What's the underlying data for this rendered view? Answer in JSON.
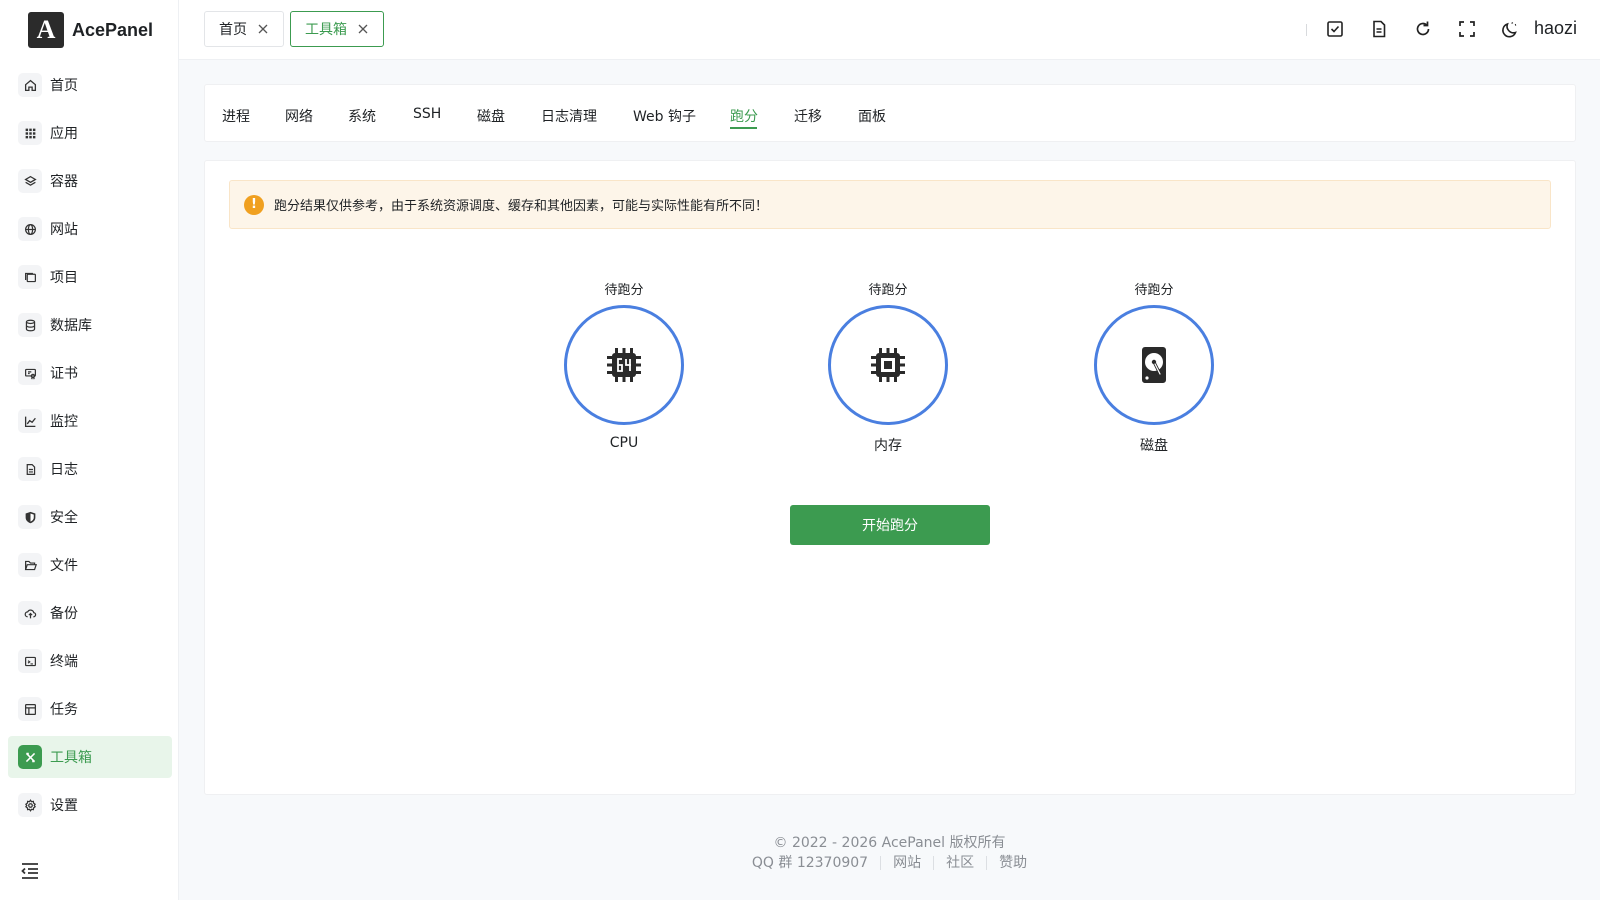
{
  "app": {
    "logo_text": "AcePanel",
    "logo_mark": "A"
  },
  "sidebar": {
    "items": [
      {
        "label": "首页",
        "icon": "home-icon"
      },
      {
        "label": "应用",
        "icon": "grid-icon"
      },
      {
        "label": "容器",
        "icon": "layers-icon"
      },
      {
        "label": "网站",
        "icon": "globe-icon"
      },
      {
        "label": "项目",
        "icon": "folders-icon"
      },
      {
        "label": "数据库",
        "icon": "database-icon"
      },
      {
        "label": "证书",
        "icon": "certificate-icon"
      },
      {
        "label": "监控",
        "icon": "chart-line-icon"
      },
      {
        "label": "日志",
        "icon": "document-icon"
      },
      {
        "label": "安全",
        "icon": "shield-icon"
      },
      {
        "label": "文件",
        "icon": "folder-open-icon"
      },
      {
        "label": "备份",
        "icon": "cloud-upload-icon"
      },
      {
        "label": "终端",
        "icon": "terminal-icon"
      },
      {
        "label": "任务",
        "icon": "task-list-icon"
      },
      {
        "label": "工具箱",
        "icon": "tools-icon",
        "active": true
      },
      {
        "label": "设置",
        "icon": "gear-icon"
      }
    ]
  },
  "header": {
    "tabs": [
      {
        "label": "首页",
        "active": false
      },
      {
        "label": "工具箱",
        "active": true
      }
    ],
    "icons": [
      "checkbox-icon",
      "notes-icon",
      "refresh-icon",
      "fullscreen-icon",
      "moon-icon"
    ],
    "username": "haozi"
  },
  "subtabs": {
    "items": [
      "进程",
      "网络",
      "系统",
      "SSH",
      "磁盘",
      "日志清理",
      "Web 钩子",
      "跑分",
      "迁移",
      "面板"
    ],
    "active": "跑分"
  },
  "benchmark": {
    "notice": "跑分结果仅供参考，由于系统资源调度、缓存和其他因素，可能与实际性能有所不同！",
    "cards": [
      {
        "status": "待跑分",
        "label": "CPU",
        "icon": "cpu-64-icon"
      },
      {
        "status": "待跑分",
        "label": "内存",
        "icon": "memory-chip-icon"
      },
      {
        "status": "待跑分",
        "label": "磁盘",
        "icon": "hard-drive-icon"
      }
    ],
    "start_button": "开始跑分"
  },
  "footer": {
    "copyright": "© 2022 - 2026 AcePanel 版权所有",
    "qq": "QQ 群 12370907",
    "links": [
      "网站",
      "社区",
      "赞助"
    ]
  },
  "colors": {
    "accent": "#3c9b50",
    "ring": "#4a7fe0",
    "warning": "#f0a020"
  }
}
